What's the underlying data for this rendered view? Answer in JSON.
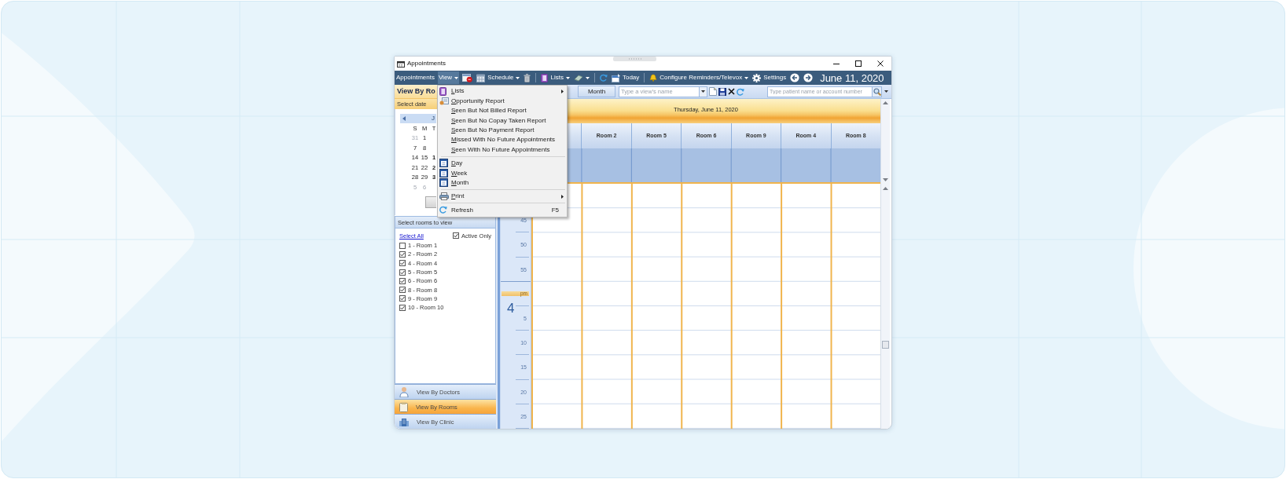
{
  "window": {
    "title": "Appointments"
  },
  "toolbar": {
    "appointments": "Appointments",
    "view": "View",
    "schedule": "Schedule",
    "lists": "Lists",
    "today": "Today",
    "reminders": "Configure Reminders/Televox",
    "settings": "Settings",
    "date": "June 11, 2020"
  },
  "view_menu": {
    "open": true,
    "items": [
      {
        "kind": "item",
        "label": "Lists",
        "underline_first": true,
        "submenu": true
      },
      {
        "kind": "item",
        "label": "Opportunity Report",
        "underline_first": true,
        "submenu": false
      },
      {
        "kind": "item",
        "label": "Seen But Not Billed Report",
        "underline_first": true,
        "submenu": false
      },
      {
        "kind": "item",
        "label": "Seen But No Copay Taken Report",
        "underline_first": true,
        "submenu": false
      },
      {
        "kind": "item",
        "label": "Seen But No Payment Report",
        "underline_first": true,
        "submenu": false
      },
      {
        "kind": "item",
        "label": "Missed With No Future Appointments",
        "underline_first": true,
        "submenu": false
      },
      {
        "kind": "item",
        "label": "Seen With No Future Appointments",
        "underline_first": true,
        "submenu": false
      },
      {
        "kind": "separator"
      },
      {
        "kind": "item",
        "label": "Day",
        "underline_first": true,
        "submenu": false
      },
      {
        "kind": "item",
        "label": "Week",
        "underline_first": true,
        "submenu": false
      },
      {
        "kind": "item",
        "label": "Month",
        "underline_first": true,
        "submenu": false
      },
      {
        "kind": "separator"
      },
      {
        "kind": "item",
        "label": "Print",
        "underline_first": true,
        "submenu": true
      },
      {
        "kind": "separator"
      },
      {
        "kind": "item",
        "label": "Refresh",
        "underline_first": false,
        "submenu": false,
        "shortcut": "F5"
      }
    ]
  },
  "left_panel": {
    "title": "View By Ro",
    "date_label": "Select date",
    "calendar": {
      "month": "J",
      "weekdays": [
        "S",
        "M",
        "T"
      ],
      "weeks": [
        [
          {
            "day": "31",
            "muted": true,
            "bold": false
          },
          {
            "day": "1",
            "muted": false,
            "bold": false
          }
        ],
        [
          {
            "day": "7",
            "muted": false,
            "bold": false
          },
          {
            "day": "8",
            "muted": false,
            "bold": false
          }
        ],
        [
          {
            "day": "14",
            "muted": false,
            "bold": false
          },
          {
            "day": "15",
            "muted": false,
            "bold": false
          },
          {
            "day": "1",
            "muted": false,
            "bold": true
          }
        ],
        [
          {
            "day": "21",
            "muted": false,
            "bold": false
          },
          {
            "day": "22",
            "muted": false,
            "bold": false
          },
          {
            "day": "2",
            "muted": false,
            "bold": true
          }
        ],
        [
          {
            "day": "28",
            "muted": false,
            "bold": false
          },
          {
            "day": "29",
            "muted": false,
            "bold": false
          },
          {
            "day": "3",
            "muted": false,
            "bold": true
          }
        ],
        [
          {
            "day": "5",
            "muted": true,
            "bold": false
          },
          {
            "day": "6",
            "muted": true,
            "bold": false
          }
        ]
      ]
    },
    "rooms_label": "Select rooms to view",
    "select_all": "Select All",
    "active_only": {
      "label": "Active Only",
      "checked": true
    },
    "rooms": [
      {
        "label": "1 - Room 1",
        "checked": false
      },
      {
        "label": "2 - Room 2",
        "checked": true
      },
      {
        "label": "4 - Room 4",
        "checked": true
      },
      {
        "label": "5 - Room 5",
        "checked": true
      },
      {
        "label": "6 - Room 6",
        "checked": true
      },
      {
        "label": "8 - Room 8",
        "checked": true
      },
      {
        "label": "9 - Room 9",
        "checked": true
      },
      {
        "label": "10 - Room 10",
        "checked": true
      }
    ],
    "nav": [
      {
        "label": "View By Doctors",
        "selected": false
      },
      {
        "label": "View By Rooms",
        "selected": true
      },
      {
        "label": "View By Clinic",
        "selected": false
      }
    ]
  },
  "view_bar": {
    "buttons": [
      {
        "label": "Month",
        "selected": false
      }
    ],
    "view_name": {
      "placeholder": "Type a view's name"
    },
    "search": {
      "placeholder": "Type patient name or account number"
    }
  },
  "schedule": {
    "date": "Thursday, June 11, 2020",
    "columns": [
      "Room 2",
      "Room 5",
      "Room 6",
      "Room 9",
      "Room 4",
      "Room 8"
    ],
    "time_rows": [
      {
        "kind": "minute",
        "label": "45"
      },
      {
        "kind": "minute",
        "label": "50"
      },
      {
        "kind": "minute",
        "label": "55"
      },
      {
        "kind": "hour",
        "label": "pm",
        "hour": "4"
      },
      {
        "kind": "minute",
        "label": "5"
      },
      {
        "kind": "minute",
        "label": "10"
      },
      {
        "kind": "minute",
        "label": "15"
      },
      {
        "kind": "minute",
        "label": "20"
      },
      {
        "kind": "minute",
        "label": "25"
      }
    ]
  }
}
